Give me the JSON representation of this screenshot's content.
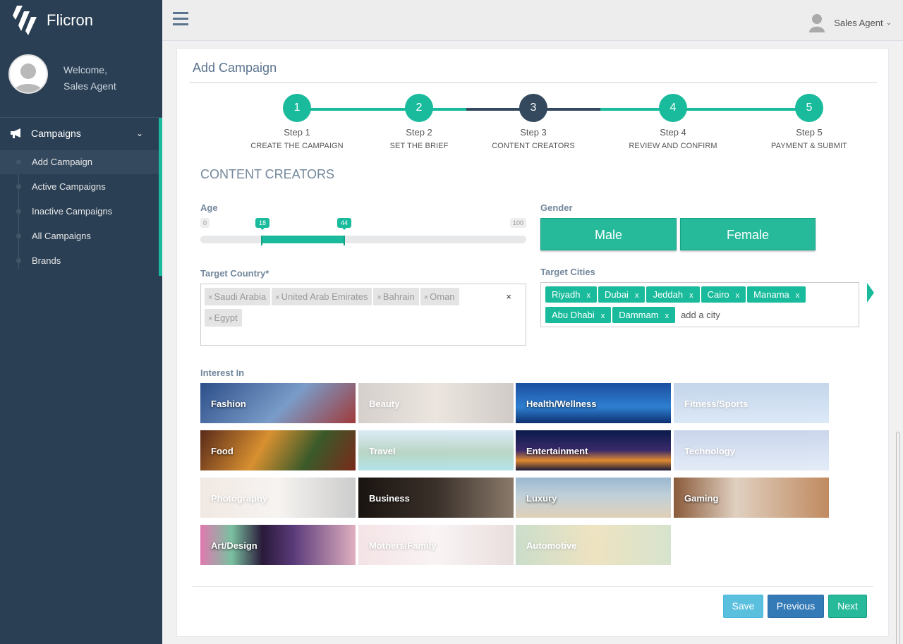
{
  "brand": {
    "name": "Flicron"
  },
  "profile": {
    "welcome": "Welcome,",
    "name": "Sales Agent"
  },
  "sidebar": {
    "section": "Campaigns",
    "items": [
      {
        "label": "Add Campaign"
      },
      {
        "label": "Active Campaigns"
      },
      {
        "label": "Inactive Campaigns"
      },
      {
        "label": "All Campaigns"
      },
      {
        "label": "Brands"
      }
    ]
  },
  "topbar": {
    "user": "Sales Agent"
  },
  "panel": {
    "title": "Add Campaign"
  },
  "wizard": {
    "steps": [
      {
        "num": "1",
        "label": "Step 1",
        "sub": "CREATE THE CAMPAIGN"
      },
      {
        "num": "2",
        "label": "Step 2",
        "sub": "SET THE BRIEF"
      },
      {
        "num": "3",
        "label": "Step 3",
        "sub": "CONTENT CREATORS"
      },
      {
        "num": "4",
        "label": "Step 4",
        "sub": "REVIEW AND CONFIRM"
      },
      {
        "num": "5",
        "label": "Step 5",
        "sub": "PAYMENT & SUBMIT"
      }
    ],
    "current": 3
  },
  "section": {
    "title": "CONTENT CREATORS"
  },
  "age": {
    "label": "Age",
    "min": "0",
    "max": "100",
    "from": "18",
    "to": "44"
  },
  "gender": {
    "label": "Gender",
    "male": "Male",
    "female": "Female"
  },
  "country": {
    "label": "Target Country*",
    "tags": [
      "Saudi Arabia",
      "United Arab Emirates",
      "Bahrain",
      "Oman",
      "Egypt"
    ],
    "tag_remove": "×",
    "clear": "×"
  },
  "cities": {
    "label": "Target Cities",
    "tags": [
      "Riyadh",
      "Dubai",
      "Jeddah",
      "Cairo",
      "Manama",
      "Abu Dhabi",
      "Dammam"
    ],
    "tag_remove": "x",
    "placeholder": "add a city"
  },
  "interests": {
    "label": "Interest In",
    "items": [
      {
        "label": "Fashion",
        "selected": true
      },
      {
        "label": "Beauty",
        "selected": false
      },
      {
        "label": "Health/Wellness",
        "selected": true
      },
      {
        "label": "Fitness/Sports",
        "selected": false
      },
      {
        "label": "Food",
        "selected": true
      },
      {
        "label": "Travel",
        "selected": false
      },
      {
        "label": "Entertainment",
        "selected": true
      },
      {
        "label": "Technology",
        "selected": false
      },
      {
        "label": "Photography",
        "selected": false
      },
      {
        "label": "Business",
        "selected": true
      },
      {
        "label": "Luxury",
        "selected": true
      },
      {
        "label": "Gaming",
        "selected": true
      },
      {
        "label": "Art/Design",
        "selected": true
      },
      {
        "label": "Mothers/Family",
        "selected": false
      },
      {
        "label": "Automotive",
        "selected": false
      }
    ]
  },
  "actions": {
    "save": "Save",
    "previous": "Previous",
    "next": "Next"
  },
  "colors": {
    "accent": "#1abb9c",
    "sidebar": "#2a3f54",
    "step_active": "#34495e",
    "save": "#5bc0de",
    "previous": "#337ab7",
    "next": "#26b99a"
  }
}
